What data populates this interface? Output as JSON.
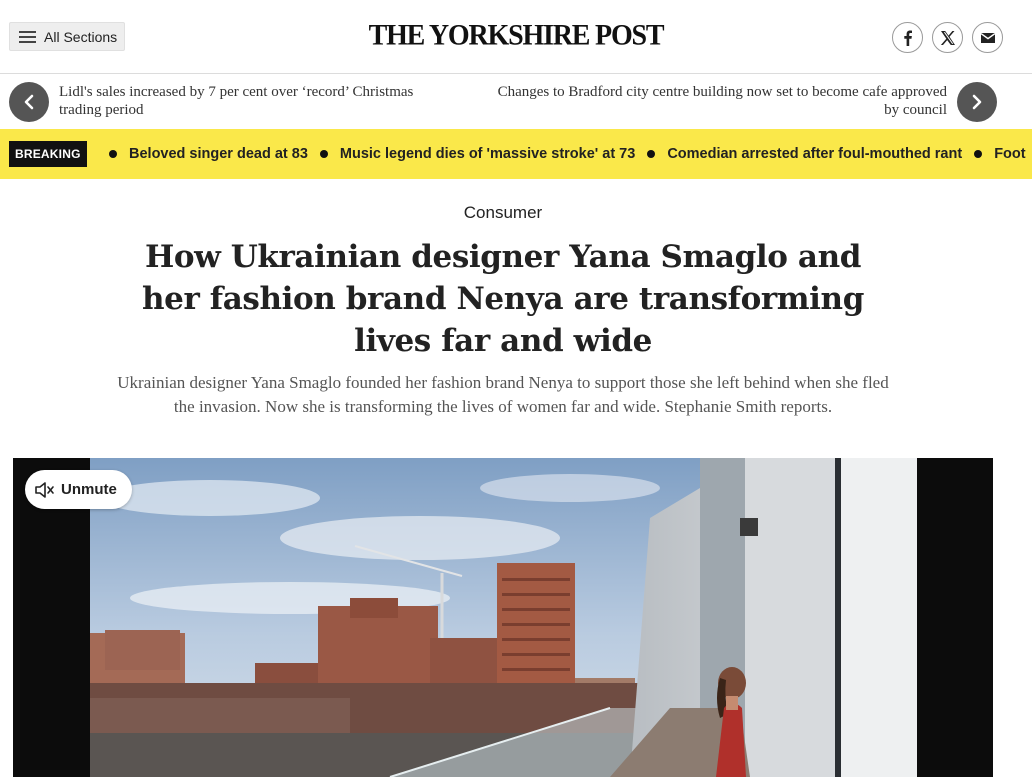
{
  "header": {
    "sections_label": "All Sections",
    "masthead": "THE YORKSHIRE POST",
    "social": [
      {
        "name": "facebook-icon"
      },
      {
        "name": "x-icon"
      },
      {
        "name": "email-icon"
      }
    ]
  },
  "nav": {
    "prev_title": "Lidl's sales increased by 7 per cent over ‘record’ Christmas trading period",
    "next_title": "Changes to Bradford city centre building now set to become cafe approved by council"
  },
  "breaking": {
    "label": "BREAKING",
    "items": [
      "Beloved singer dead at 83",
      "Music legend dies of 'massive stroke' at 73",
      "Comedian arrested after foul-mouthed rant",
      "Foot"
    ],
    "bar_color": "#fae84a"
  },
  "article": {
    "category": "Consumer",
    "headline": "How Ukrainian designer Yana Smaglo and her fashion brand Nenya are transforming lives far and wide",
    "standfirst": "Ukrainian designer Yana Smaglo founded her fashion brand Nenya to support those she left behind when she fled the invasion. Now she is transforming the lives of women far and wide. Stephanie Smith reports."
  },
  "video": {
    "unmute_label": "Unmute"
  }
}
